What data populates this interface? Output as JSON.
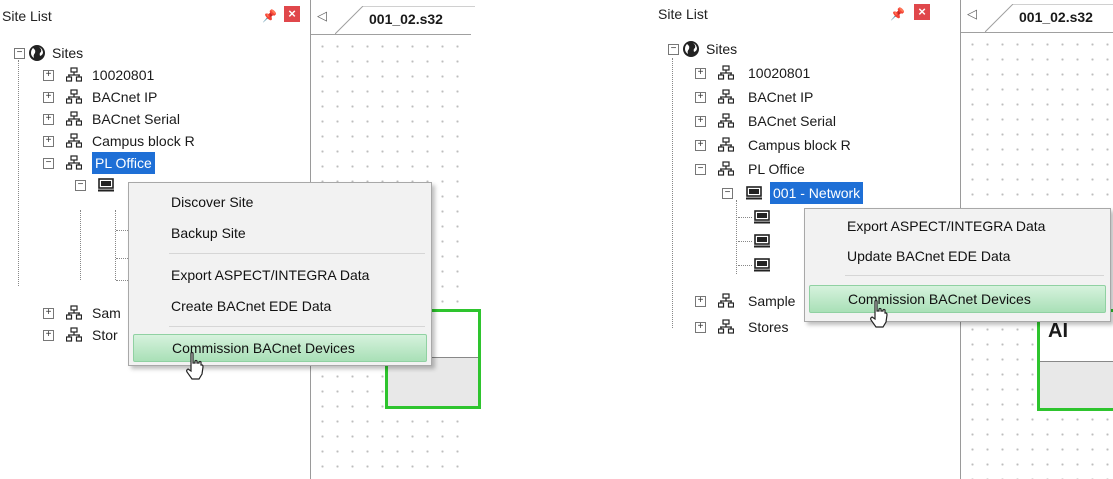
{
  "colors": {
    "accent_selection": "#1e6fd6",
    "close_button": "#e0474b",
    "block_border": "#2ec42e",
    "menu_highlight": "#a9e0b7"
  },
  "left": {
    "site_list": {
      "title": "Site List",
      "pin_icon": "pin-icon",
      "close_icon": "close-icon",
      "tree": {
        "root": "Sites",
        "items": [
          "10020801",
          "BACnet IP",
          "BACnet Serial",
          "Campus block R",
          "PL Office"
        ],
        "hidden_items": [
          "Sam",
          "Stor"
        ]
      }
    },
    "document": {
      "tab_label": "001_02.s32"
    },
    "context_menu": {
      "items": [
        "Discover Site",
        "Backup Site",
        "Export ASPECT/INTEGRA Data",
        "Create BACnet EDE Data",
        "Commission BACnet Devices"
      ],
      "highlighted": "Commission BACnet Devices"
    }
  },
  "right": {
    "site_list": {
      "title": "Site List",
      "tree": {
        "root": "Sites",
        "items": [
          "10020801",
          "BACnet IP",
          "BACnet Serial",
          "Campus block R",
          "PL Office",
          "Sample",
          "Stores"
        ],
        "network": "001 - Network"
      }
    },
    "document": {
      "tab_label": "001_02.s32",
      "block_label": "AI"
    },
    "context_menu": {
      "items": [
        "Export ASPECT/INTEGRA Data",
        "Update BACnet EDE Data",
        "Commission BACnet Devices"
      ],
      "highlighted": "Commission BACnet Devices"
    }
  }
}
